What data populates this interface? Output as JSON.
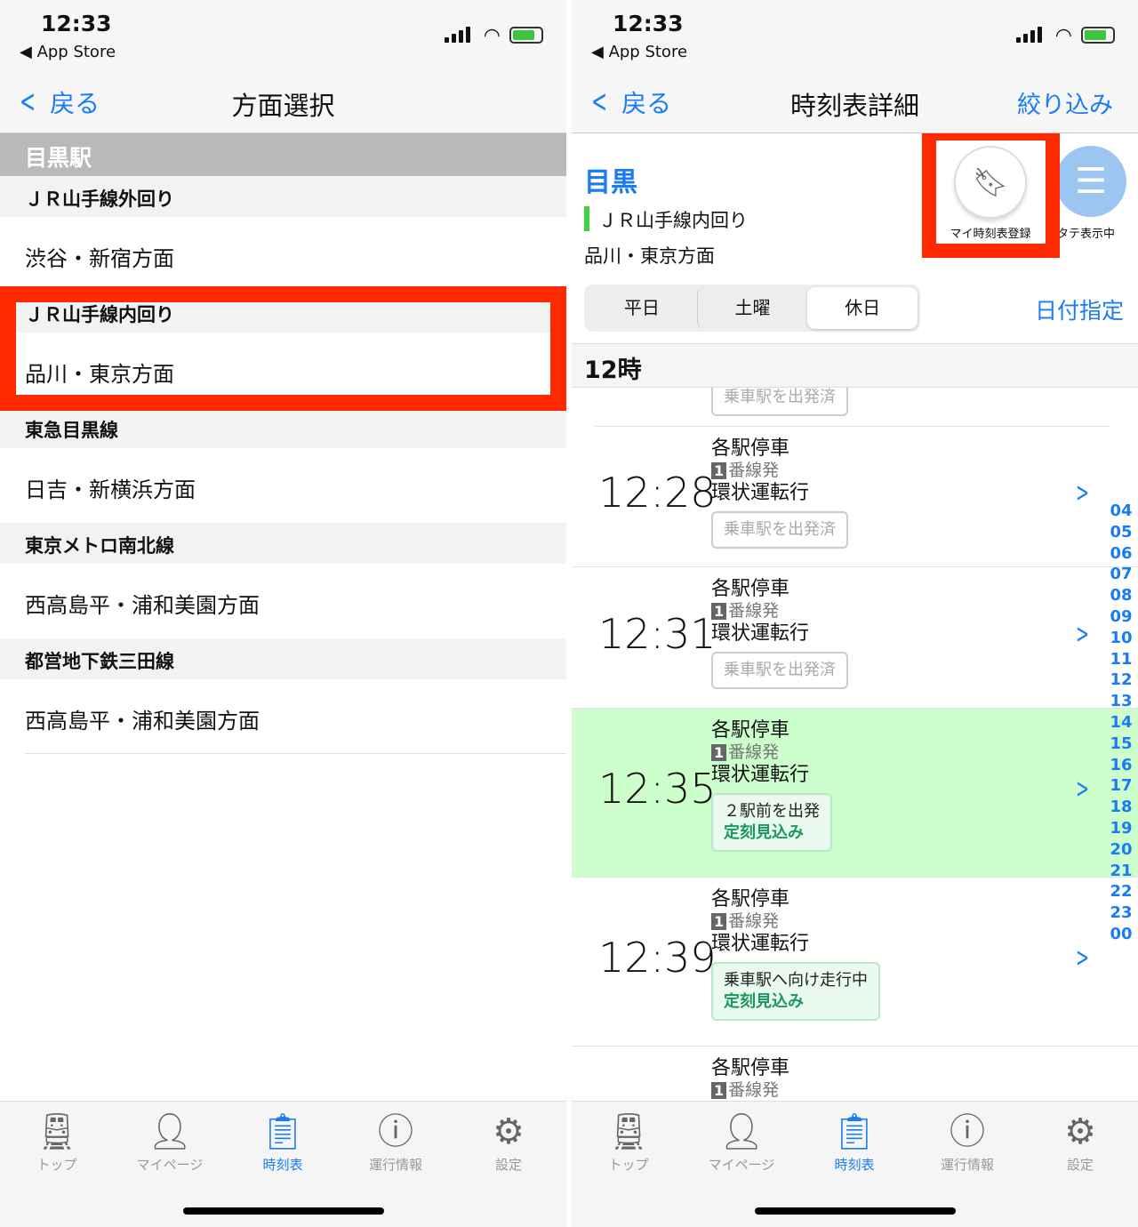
{
  "status": {
    "time": "12:33",
    "back_app": "◀ App Store"
  },
  "left": {
    "nav": {
      "back": "戻る",
      "title": "方面選択"
    },
    "station": "目黒駅",
    "lines": [
      {
        "name": "ＪＲ山手線外回り",
        "direction": "渋谷・新宿方面"
      },
      {
        "name": "ＪＲ山手線内回り",
        "direction": "品川・東京方面",
        "highlighted": true
      },
      {
        "name": "東急目黒線",
        "direction": "日吉・新横浜方面"
      },
      {
        "name": "東京メトロ南北線",
        "direction": "西高島平・浦和美園方面"
      },
      {
        "name": "都営地下鉄三田線",
        "direction": "西高島平・浦和美園方面"
      }
    ]
  },
  "right": {
    "nav": {
      "back": "戻る",
      "title": "時刻表詳細",
      "filter": "絞り込み"
    },
    "station": "目黒",
    "line": "ＪＲ山手線内回り",
    "line_color": "#3ed23e",
    "direction": "品川・東京方面",
    "bookmark_label": "マイ時刻表登録",
    "vertical_label": "タテ表示中",
    "day_tabs": [
      "平日",
      "土曜",
      "休日"
    ],
    "day_selected": "休日",
    "date_pick": "日付指定",
    "hour": "12時",
    "partial_badge": "乗車駅を出発済",
    "trains": [
      {
        "time": "12:28",
        "type": "各駅停車",
        "platform": "1",
        "platform_suffix": "番線発",
        "dest": "環状運転行",
        "status": "乗車駅を出発済"
      },
      {
        "time": "12:31",
        "type": "各駅停車",
        "platform": "1",
        "platform_suffix": "番線発",
        "dest": "環状運転行",
        "status": "乗車駅を出発済"
      },
      {
        "time": "12:35",
        "type": "各駅停車",
        "platform": "1",
        "platform_suffix": "番線発",
        "dest": "環状運転行",
        "status": "２駅前を出発",
        "delay": "定刻見込み",
        "highlighted": true
      },
      {
        "time": "12:39",
        "type": "各駅停車",
        "platform": "1",
        "platform_suffix": "番線発",
        "dest": "環状運転行",
        "status": "乗車駅へ向け走行中",
        "delay": "定刻見込み"
      }
    ],
    "next_partial": {
      "type": "各駅停車",
      "platform": "1",
      "platform_suffix": "番線発"
    },
    "hour_index": [
      "04",
      "05",
      "06",
      "07",
      "08",
      "09",
      "10",
      "11",
      "12",
      "13",
      "14",
      "15",
      "16",
      "17",
      "18",
      "19",
      "20",
      "21",
      "22",
      "23",
      "00"
    ]
  },
  "tabs": [
    {
      "label": "トップ",
      "icon": "train-icon"
    },
    {
      "label": "マイページ",
      "icon": "person-icon"
    },
    {
      "label": "時刻表",
      "icon": "timetable-icon",
      "active": true
    },
    {
      "label": "運行情報",
      "icon": "info-icon"
    },
    {
      "label": "設定",
      "icon": "gear-icon"
    }
  ],
  "colors": {
    "accent": "#1a7cf5",
    "highlight_box": "#ff2a00",
    "current_train_bg": "#ccffcc"
  }
}
